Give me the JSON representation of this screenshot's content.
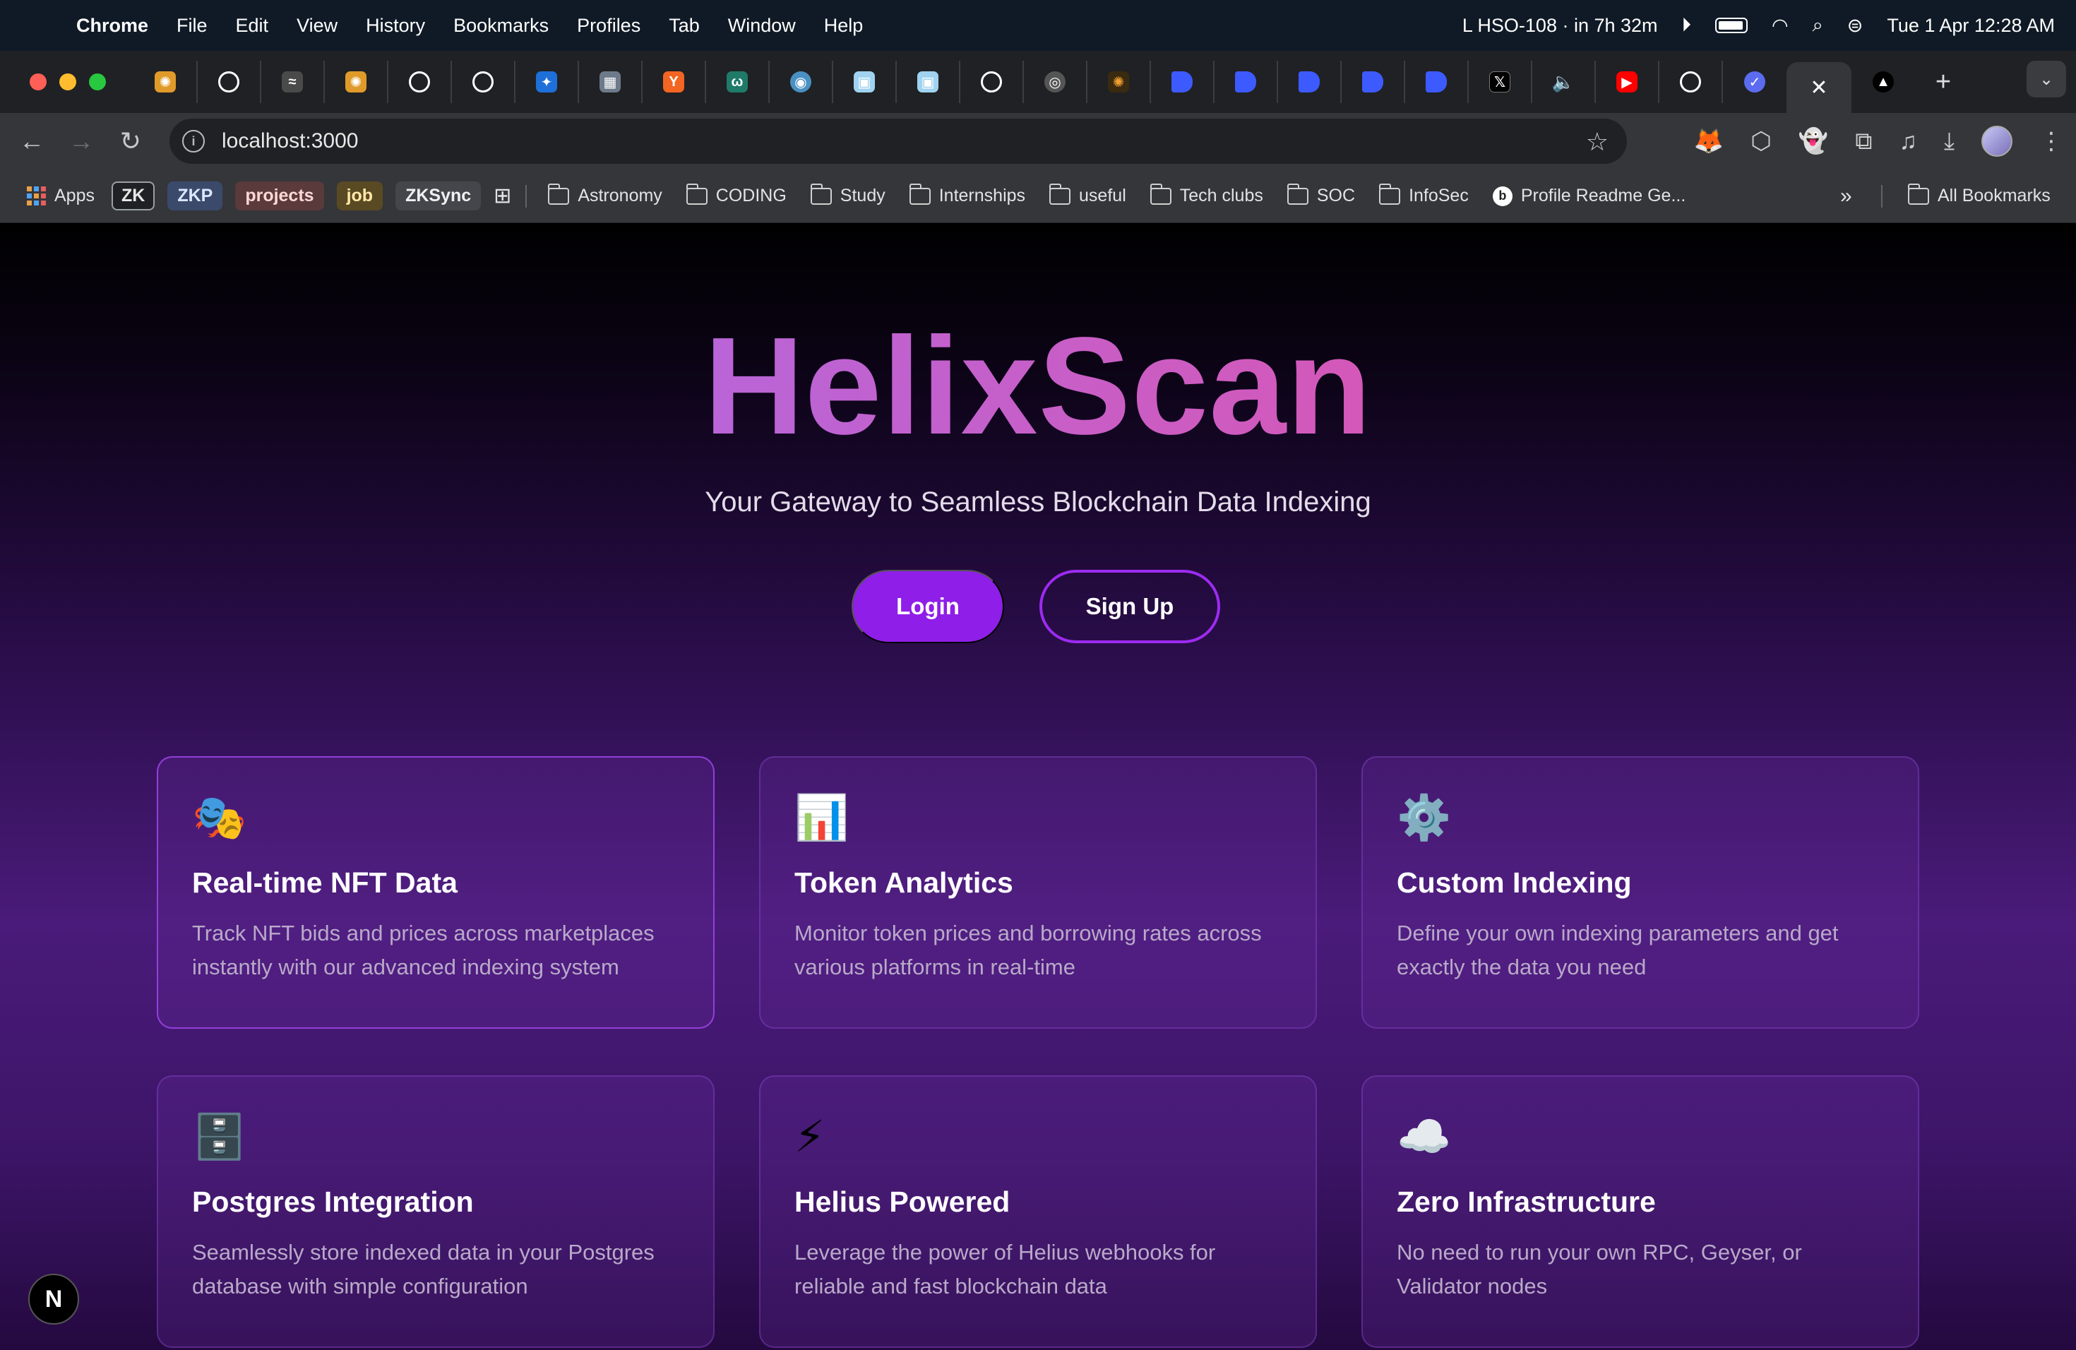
{
  "menubar": {
    "app_name": "Chrome",
    "items": [
      "File",
      "Edit",
      "View",
      "History",
      "Bookmarks",
      "Profiles",
      "Tab",
      "Window",
      "Help"
    ],
    "calendar_event": "L HSO-108 · in 7h 32m",
    "datetime": "Tue 1 Apr  12:28 AM"
  },
  "browser": {
    "url": "localhost:3000",
    "bookmarks": {
      "apps_label": "Apps",
      "chips": [
        {
          "label": "ZK",
          "bg": "#202124",
          "fg": "#e8e8e8",
          "border": "#9aa0a6"
        },
        {
          "label": "ZKP",
          "bg": "#3b4a6b",
          "fg": "#dce6ff",
          "border": "#3b4a6b"
        },
        {
          "label": "projects",
          "bg": "#5a3a3a",
          "fg": "#ffd7d7",
          "border": "#5a3a3a"
        },
        {
          "label": "job",
          "bg": "#5a4a23",
          "fg": "#ffe8a8",
          "border": "#5a4a23"
        },
        {
          "label": "ZKSync",
          "bg": "#44464b",
          "fg": "#f0f0f0",
          "border": "#44464b"
        }
      ],
      "folders": [
        "Astronomy",
        "CODING",
        "Study",
        "Internships",
        "useful",
        "Tech clubs",
        "SOC",
        "InfoSec"
      ],
      "page_link": "Profile Readme Ge...",
      "all_bookmarks": "All Bookmarks"
    }
  },
  "hero": {
    "title": "HelixScan",
    "subtitle": "Your Gateway to Seamless Blockchain Data Indexing",
    "login_label": "Login",
    "signup_label": "Sign Up"
  },
  "features": [
    {
      "emoji": "🎭",
      "icon_name": "masks-icon",
      "title": "Real-time NFT Data",
      "desc_line1": "Track NFT bids and prices across marketplaces",
      "desc_line2": "instantly with our advanced indexing system"
    },
    {
      "emoji": "📊",
      "icon_name": "bar-chart-icon",
      "title": "Token Analytics",
      "desc_line1": "Monitor token prices and borrowing rates across",
      "desc_line2": "various platforms in real-time"
    },
    {
      "emoji": "⚙️",
      "icon_name": "gear-icon",
      "title": "Custom Indexing",
      "desc_line1": "Define your own indexing parameters and get",
      "desc_line2": "exactly the data you need"
    },
    {
      "emoji": "🗄️",
      "icon_name": "file-cabinet-icon",
      "title": "Postgres Integration",
      "desc_line1": "Seamlessly store indexed data in your Postgres",
      "desc_line2": "database with simple configuration"
    },
    {
      "emoji": "⚡",
      "icon_name": "lightning-icon",
      "title": "Helius Powered",
      "desc_line1": "Leverage the power of Helius webhooks for",
      "desc_line2": "reliable and fast blockchain data"
    },
    {
      "emoji": "☁️",
      "icon_name": "cloud-icon",
      "title": "Zero Infrastructure",
      "desc_line1": "No need to run your own RPC, Geyser, or",
      "desc_line2": "Validator nodes"
    }
  ],
  "nextjs_badge": "N",
  "colors": {
    "accent": "#8f1ee8",
    "title_gradient_start": "#b965d8",
    "title_gradient_end": "#d458b8"
  }
}
